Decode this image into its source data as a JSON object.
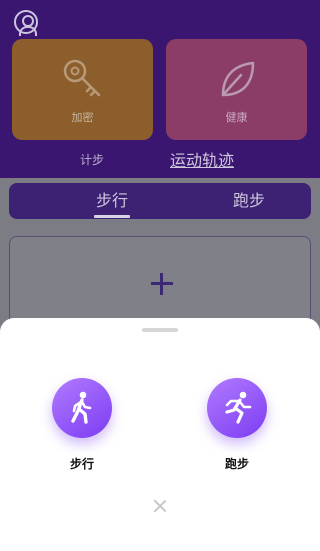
{
  "header": {
    "cards": [
      {
        "label": "加密",
        "icon": "key-icon"
      },
      {
        "label": "健康",
        "icon": "leaf-icon"
      }
    ],
    "steps_label": "计步",
    "track_label": "运动轨迹"
  },
  "tabs": [
    {
      "label": "步行",
      "active": true
    },
    {
      "label": "跑步",
      "active": false
    }
  ],
  "add_card": {
    "icon": "plus-icon"
  },
  "sheet": {
    "options": [
      {
        "label": "步行",
        "icon": "walking-icon"
      },
      {
        "label": "跑步",
        "icon": "running-icon"
      }
    ],
    "close_icon": "close-icon"
  },
  "colors": {
    "accent": "#8a4cf6",
    "header_bg": "#3a1670"
  }
}
